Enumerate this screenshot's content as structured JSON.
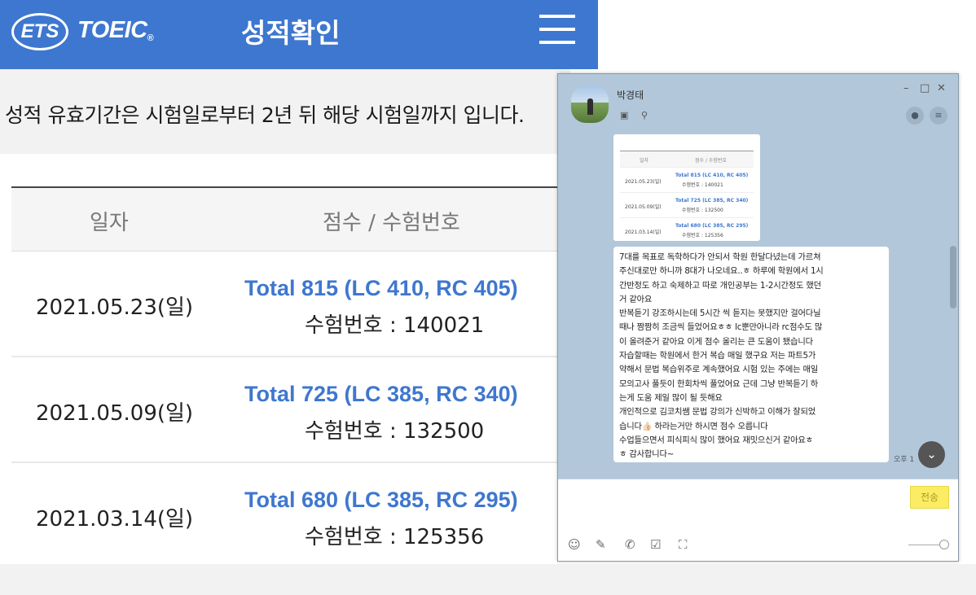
{
  "ets": {
    "logo": "ETS",
    "brand": "TOEIC",
    "brand_reg": "®",
    "title": "성적확인",
    "validity_notice": "성적 유효기간은 시험일로부터 2년 뒤 해당 시험일까지 입니다.",
    "columns": [
      "일자",
      "점수 / 수험번호"
    ],
    "rows": [
      {
        "date": "2021.05.23(일)",
        "total": "Total 815 (LC 410, RC 405)",
        "exam_id": "수험번호 : 140021"
      },
      {
        "date": "2021.05.09(일)",
        "total": "Total 725 (LC 385, RC 340)",
        "exam_id": "수험번호 : 132500"
      },
      {
        "date": "2021.03.14(일)",
        "total": "Total 680 (LC 385, RC 295)",
        "exam_id": "수험번호 : 125356"
      }
    ],
    "colors": {
      "brand_blue": "#3e77cf"
    }
  },
  "chat": {
    "contact_name": "박경태",
    "window_controls": [
      "–",
      "□",
      "✕"
    ],
    "image_message": {
      "columns": [
        "일자",
        "점수 / 수험번호"
      ],
      "rows": [
        {
          "date": "2021.05.23(일)",
          "total": "Total 815 (LC 410, RC 405)",
          "exam_id": "수험번호 : 140021"
        },
        {
          "date": "2021.05.09(일)",
          "total": "Total 725 (LC 385, RC 340)",
          "exam_id": "수험번호 : 132500"
        },
        {
          "date": "2021.03.14(일)",
          "total": "Total 680 (LC 385, RC 295)",
          "exam_id": "수험번호 : 125356"
        }
      ]
    },
    "message_lines": [
      "7대를 목표로 독학하다가 안되서 학원 한달다녔는데 가르쳐",
      "주신대로만 하니까 8대가 나오네요..ㅎ 하루에 학원에서 1시",
      "간반정도 하고 숙제하고 따로 개인공부는 1-2시간정도 했던",
      "거 같아요",
      " 반복듣기 강조하시는데 5시간 씩 듣지는 못했지만 걸어다닐",
      "때나 짬짬히 조금씩 들었어요ㅎㅎ lc뿐만아니라 rc점수도 많",
      "이 올려준거 같아요 이게 점수 올리는 큰 도움이 됐습니다",
      " 자습할때는 학원에서 한거 복습 매일 했구요 저는 파트5가",
      "약해서 문법 복습위주로 계속했어요 시험 있는 주에는 매일",
      "모의고사 풀듯이 한회차씩 풀었어요 근데 그냥 반복듣기 하",
      "는게 도움 제일 많이 될 듯해요",
      "  개인적으로 김코치쌤 문법 강의가 신박하고 이해가 잘되었",
      "습니다👍🏻 하라는거만 하시면 점수 오릅니다",
      "  수업들으면서 피식피식 많이 했어요 재밋으신거 같아요ㅎ",
      "ㅎ 감사합니다~"
    ],
    "time": "오후 1",
    "send_label": "전송",
    "colors": {
      "bg": "#b2c7da",
      "send": "#fcec63"
    }
  }
}
